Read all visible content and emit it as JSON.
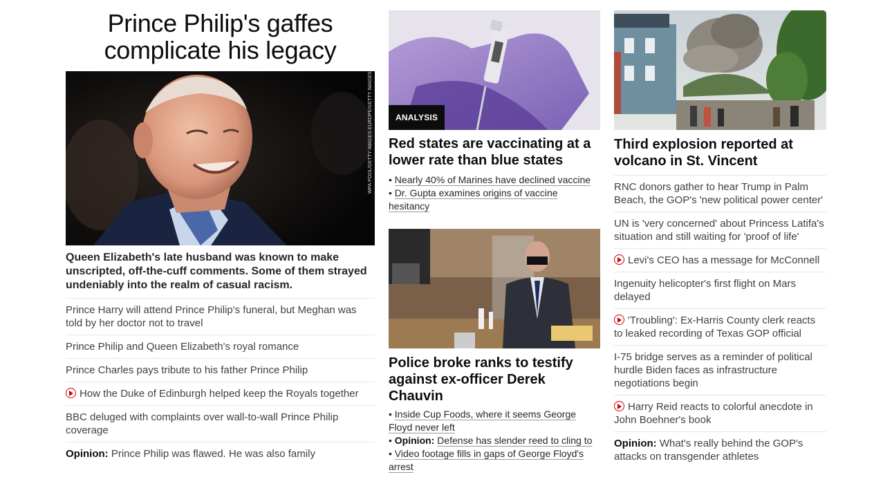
{
  "left": {
    "headline": "Prince Philip's gaffes complicate his legacy",
    "image_credit": "WPA POOL/GETTY IMAGES EUROPE/GETTY IMAGES",
    "description": "Queen Elizabeth's late husband was known to make unscripted, off-the-cuff comments. Some of them strayed undeniably into the realm of casual racism.",
    "links": [
      {
        "text": "Prince Harry will attend Prince Philip's funeral, but Meghan was told by her doctor not to travel"
      },
      {
        "text": "Prince Philip and Queen Elizabeth's royal romance"
      },
      {
        "text": "Prince Charles pays tribute to his father Prince Philip"
      },
      {
        "text": "How the Duke of Edinburgh helped keep the Royals together",
        "icon": "play-icon"
      },
      {
        "text": "BBC deluged with complaints over wall-to-wall Prince Philip coverage"
      },
      {
        "prefix": "Opinion:",
        "text": " Prince Philip was flawed. He was also family"
      }
    ]
  },
  "middle": {
    "card1": {
      "badge": "ANALYSIS",
      "headline": "Red states are vaccinating at a lower rate than blue states",
      "bullets": [
        {
          "text": "Nearly 40% of Marines have declined vaccine"
        },
        {
          "text": "Dr. Gupta examines origins of vaccine hesitancy"
        }
      ]
    },
    "card2": {
      "headline": "Police broke ranks to testify against ex-officer Derek Chauvin",
      "bullets": [
        {
          "text": "Inside Cup Foods, where it seems George Floyd never left"
        },
        {
          "prefix": "Opinion:",
          "text": "Defense has slender reed to cling to"
        },
        {
          "text": "Video footage fills in gaps of George Floyd's arrest"
        }
      ]
    }
  },
  "right": {
    "headline": "Third explosion reported at volcano in St. Vincent",
    "links": [
      {
        "text": "RNC donors gather to hear Trump in Palm Beach, the GOP's 'new political power center'"
      },
      {
        "text": "UN is 'very concerned' about Princess Latifa's situation and still waiting for 'proof of life'"
      },
      {
        "text": "Levi's CEO has a message for McConnell",
        "icon": "play-icon"
      },
      {
        "text": "Ingenuity helicopter's first flight on Mars delayed"
      },
      {
        "text": "'Troubling': Ex-Harris County clerk reacts to leaked recording of Texas GOP official",
        "icon": "play-icon"
      },
      {
        "text": "I-75 bridge serves as a reminder of political hurdle Biden faces as infrastructure negotiations begin"
      },
      {
        "text": "Harry Reid reacts to colorful anecdote in John Boehner's book",
        "icon": "play-icon"
      },
      {
        "prefix": "Opinion:",
        "text": " What's really behind the GOP's attacks on transgender athletes"
      }
    ]
  }
}
